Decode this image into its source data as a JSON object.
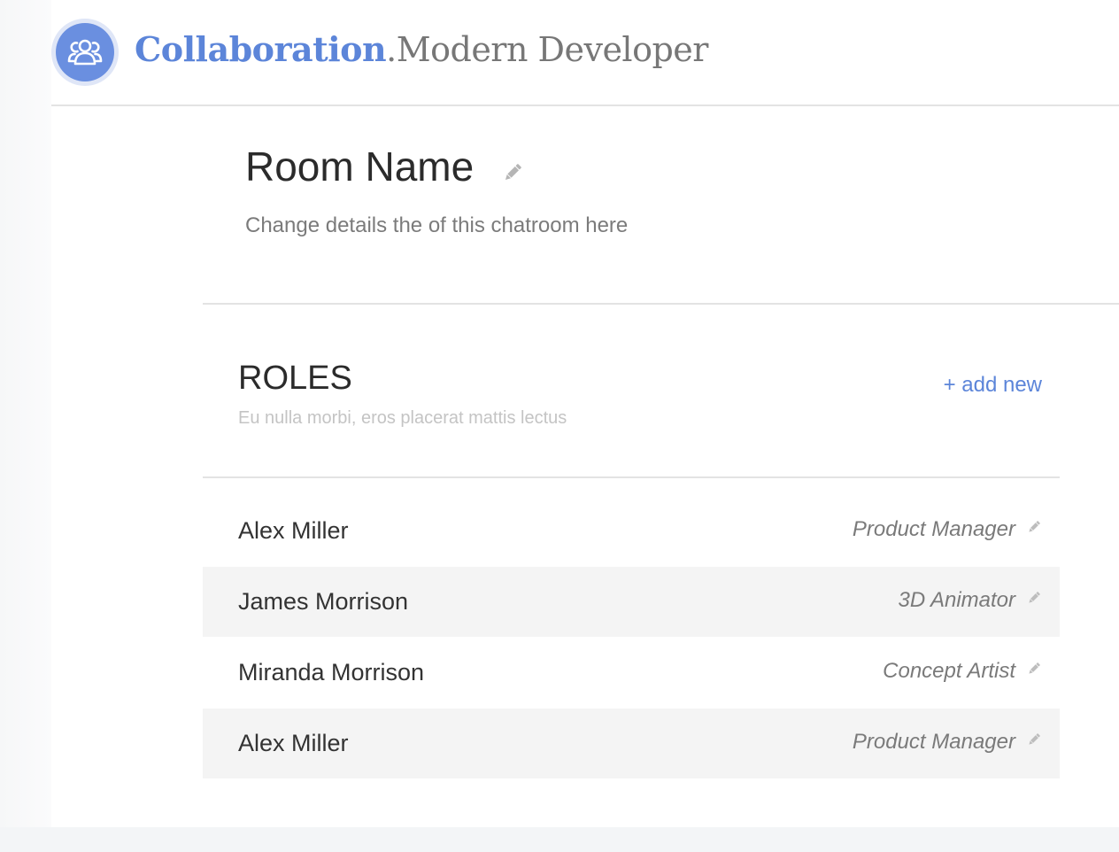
{
  "header": {
    "brand_primary": "Collaboration",
    "brand_dot": ".",
    "brand_secondary": "Modern Developer",
    "logo_icon": "users-group-icon"
  },
  "room": {
    "title": "Room Name",
    "subtitle": "Change details the of this chatroom here",
    "edit_icon": "pencil-icon"
  },
  "roles": {
    "title": "ROLES",
    "subtitle": "Eu nulla morbi, eros placerat mattis lectus",
    "add_new_label": "+ add new",
    "items": [
      {
        "name": "Alex Miller",
        "role": "Product Manager"
      },
      {
        "name": "James Morrison",
        "role": "3D Animator"
      },
      {
        "name": "Miranda Morrison",
        "role": "Concept Artist"
      },
      {
        "name": "Alex Miller",
        "role": "Product Manager"
      }
    ]
  },
  "colors": {
    "accent": "#5c85d9",
    "logo_bg": "#6a8fe0",
    "row_alt": "#f4f4f4",
    "divider": "#e3e3e3"
  }
}
